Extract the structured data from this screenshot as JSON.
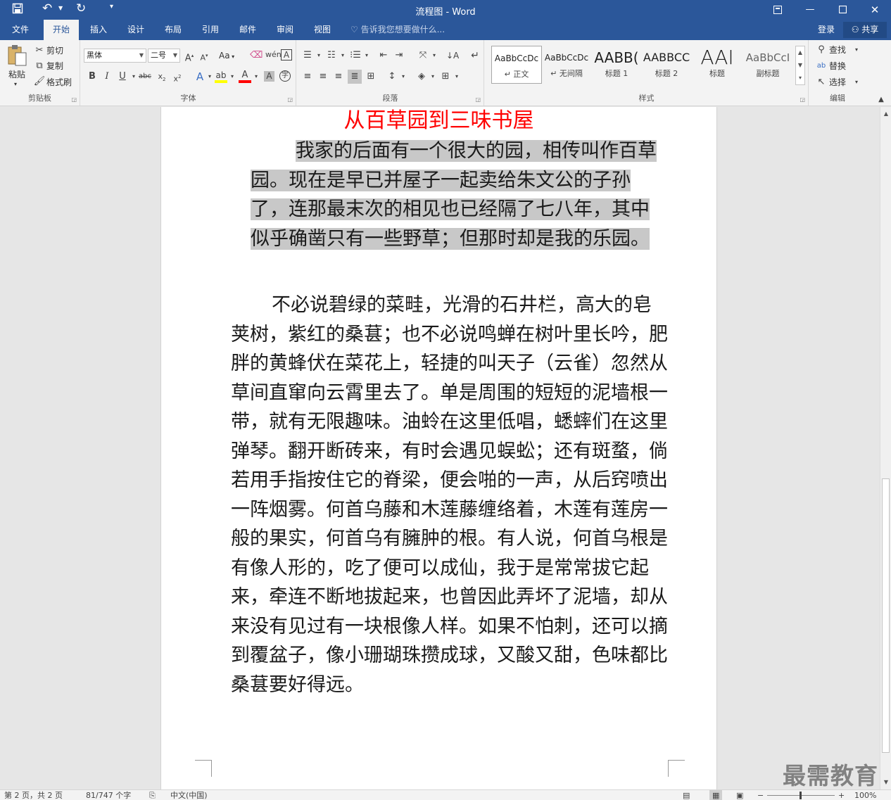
{
  "titlebar": {
    "title": "流程图 - Word",
    "save_icon": "save-icon",
    "undo_icon": "undo-icon",
    "redo_icon": "redo-icon",
    "customize_icon": "customize-icon",
    "restore_icon": "ribbon-display-icon",
    "minimize_icon": "minimize-icon",
    "maximize_icon": "maximize-icon",
    "close_icon": "close-icon"
  },
  "tabs": [
    {
      "label": "文件"
    },
    {
      "label": "开始",
      "active": true
    },
    {
      "label": "插入"
    },
    {
      "label": "设计"
    },
    {
      "label": "布局"
    },
    {
      "label": "引用"
    },
    {
      "label": "邮件"
    },
    {
      "label": "审阅"
    },
    {
      "label": "视图"
    }
  ],
  "tellme": "告诉我您想要做什么...",
  "account": {
    "signin": "登录",
    "share": "共享"
  },
  "ribbon": {
    "clipboard": {
      "label": "剪贴板",
      "paste": "粘贴",
      "cut": "剪切",
      "copy": "复制",
      "format_painter": "格式刷"
    },
    "font": {
      "label": "字体",
      "font_name": "黑体",
      "font_size": "二号",
      "change_case": "Aa"
    },
    "paragraph": {
      "label": "段落"
    },
    "styles": {
      "label": "样式",
      "items": [
        {
          "sample": "AaBbCcDc",
          "name": "↵ 正文",
          "selected": true
        },
        {
          "sample": "AaBbCcDc",
          "name": "↵ 无间隔"
        },
        {
          "sample": "AABB(",
          "name": "标题 1"
        },
        {
          "sample": "AABBCC",
          "name": "标题 2"
        },
        {
          "sample": "AAI",
          "name": "标题"
        },
        {
          "sample": "AaBbCcI",
          "name": "副标题"
        }
      ]
    },
    "editing": {
      "label": "编辑",
      "find": "查找",
      "replace": "替换",
      "select": "选择"
    }
  },
  "document": {
    "heading": "从百草园到三味书屋",
    "para1": "我家的后面有一个很大的园，相传叫作百草园。现在是早已并屋子一起卖给朱文公的子孙了，连那最末次的相见也已经隔了七八年，其中似乎确凿只有一些野草；但那时却是我的乐园。",
    "para2": "不必说碧绿的菜畦，光滑的石井栏，高大的皂荚树，紫红的桑葚；也不必说鸣蝉在树叶里长吟，肥胖的黄蜂伏在菜花上，轻捷的叫天子（云雀）忽然从草间直窜向云霄里去了。单是周围的短短的泥墙根一带，就有无限趣味。油蛉在这里低唱，蟋蟀们在这里弹琴。翻开断砖来，有时会遇见蜈蚣；还有斑蝥，倘若用手指按住它的脊梁，便会啪的一声，从后窍喷出一阵烟雾。何首乌藤和木莲藤缠络着，木莲有莲房一般的果实，何首乌有臃肿的根。有人说，何首乌根是有像人形的，吃了便可以成仙，我于是常常拔它起来，牵连不断地拔起来，也曾因此弄坏了泥墙，却从来没有见过有一块根像人样。如果不怕刺，还可以摘到覆盆子，像小珊瑚珠攒成球，又酸又甜，色味都比桑葚要好得远。"
  },
  "status": {
    "page": "第 2 页，共 2 页",
    "words": "81/747 个字",
    "language": "中文(中国)",
    "zoom": "100%"
  },
  "watermark": "最需教育",
  "colors": {
    "brand": "#2b579a",
    "heading": "#ff0000",
    "selection": "#c8c8c8"
  }
}
